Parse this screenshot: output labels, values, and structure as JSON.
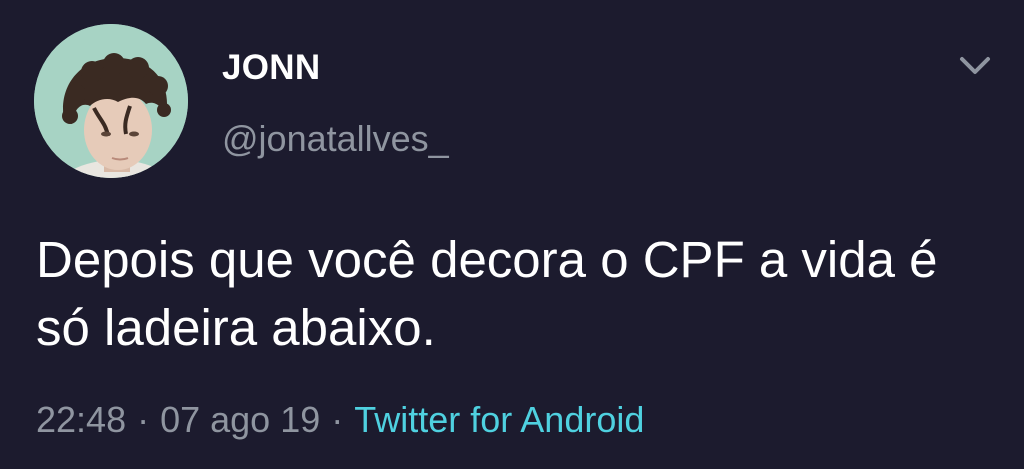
{
  "author": {
    "display_name": "JONN",
    "handle": "@jonatallves_"
  },
  "tweet": {
    "text": "Depois que você decora o CPF a vida é só ladeira abaixo.",
    "time": "22:48",
    "date": "07 ago 19",
    "separator": "·",
    "source": "Twitter for Android"
  },
  "icons": {
    "menu": "chevron-down-icon"
  },
  "colors": {
    "background": "#1c1b2e",
    "text": "#ffffff",
    "secondary_text": "#8f95a0",
    "link": "#4fd1e0",
    "avatar_background": "#a7d3c4"
  }
}
